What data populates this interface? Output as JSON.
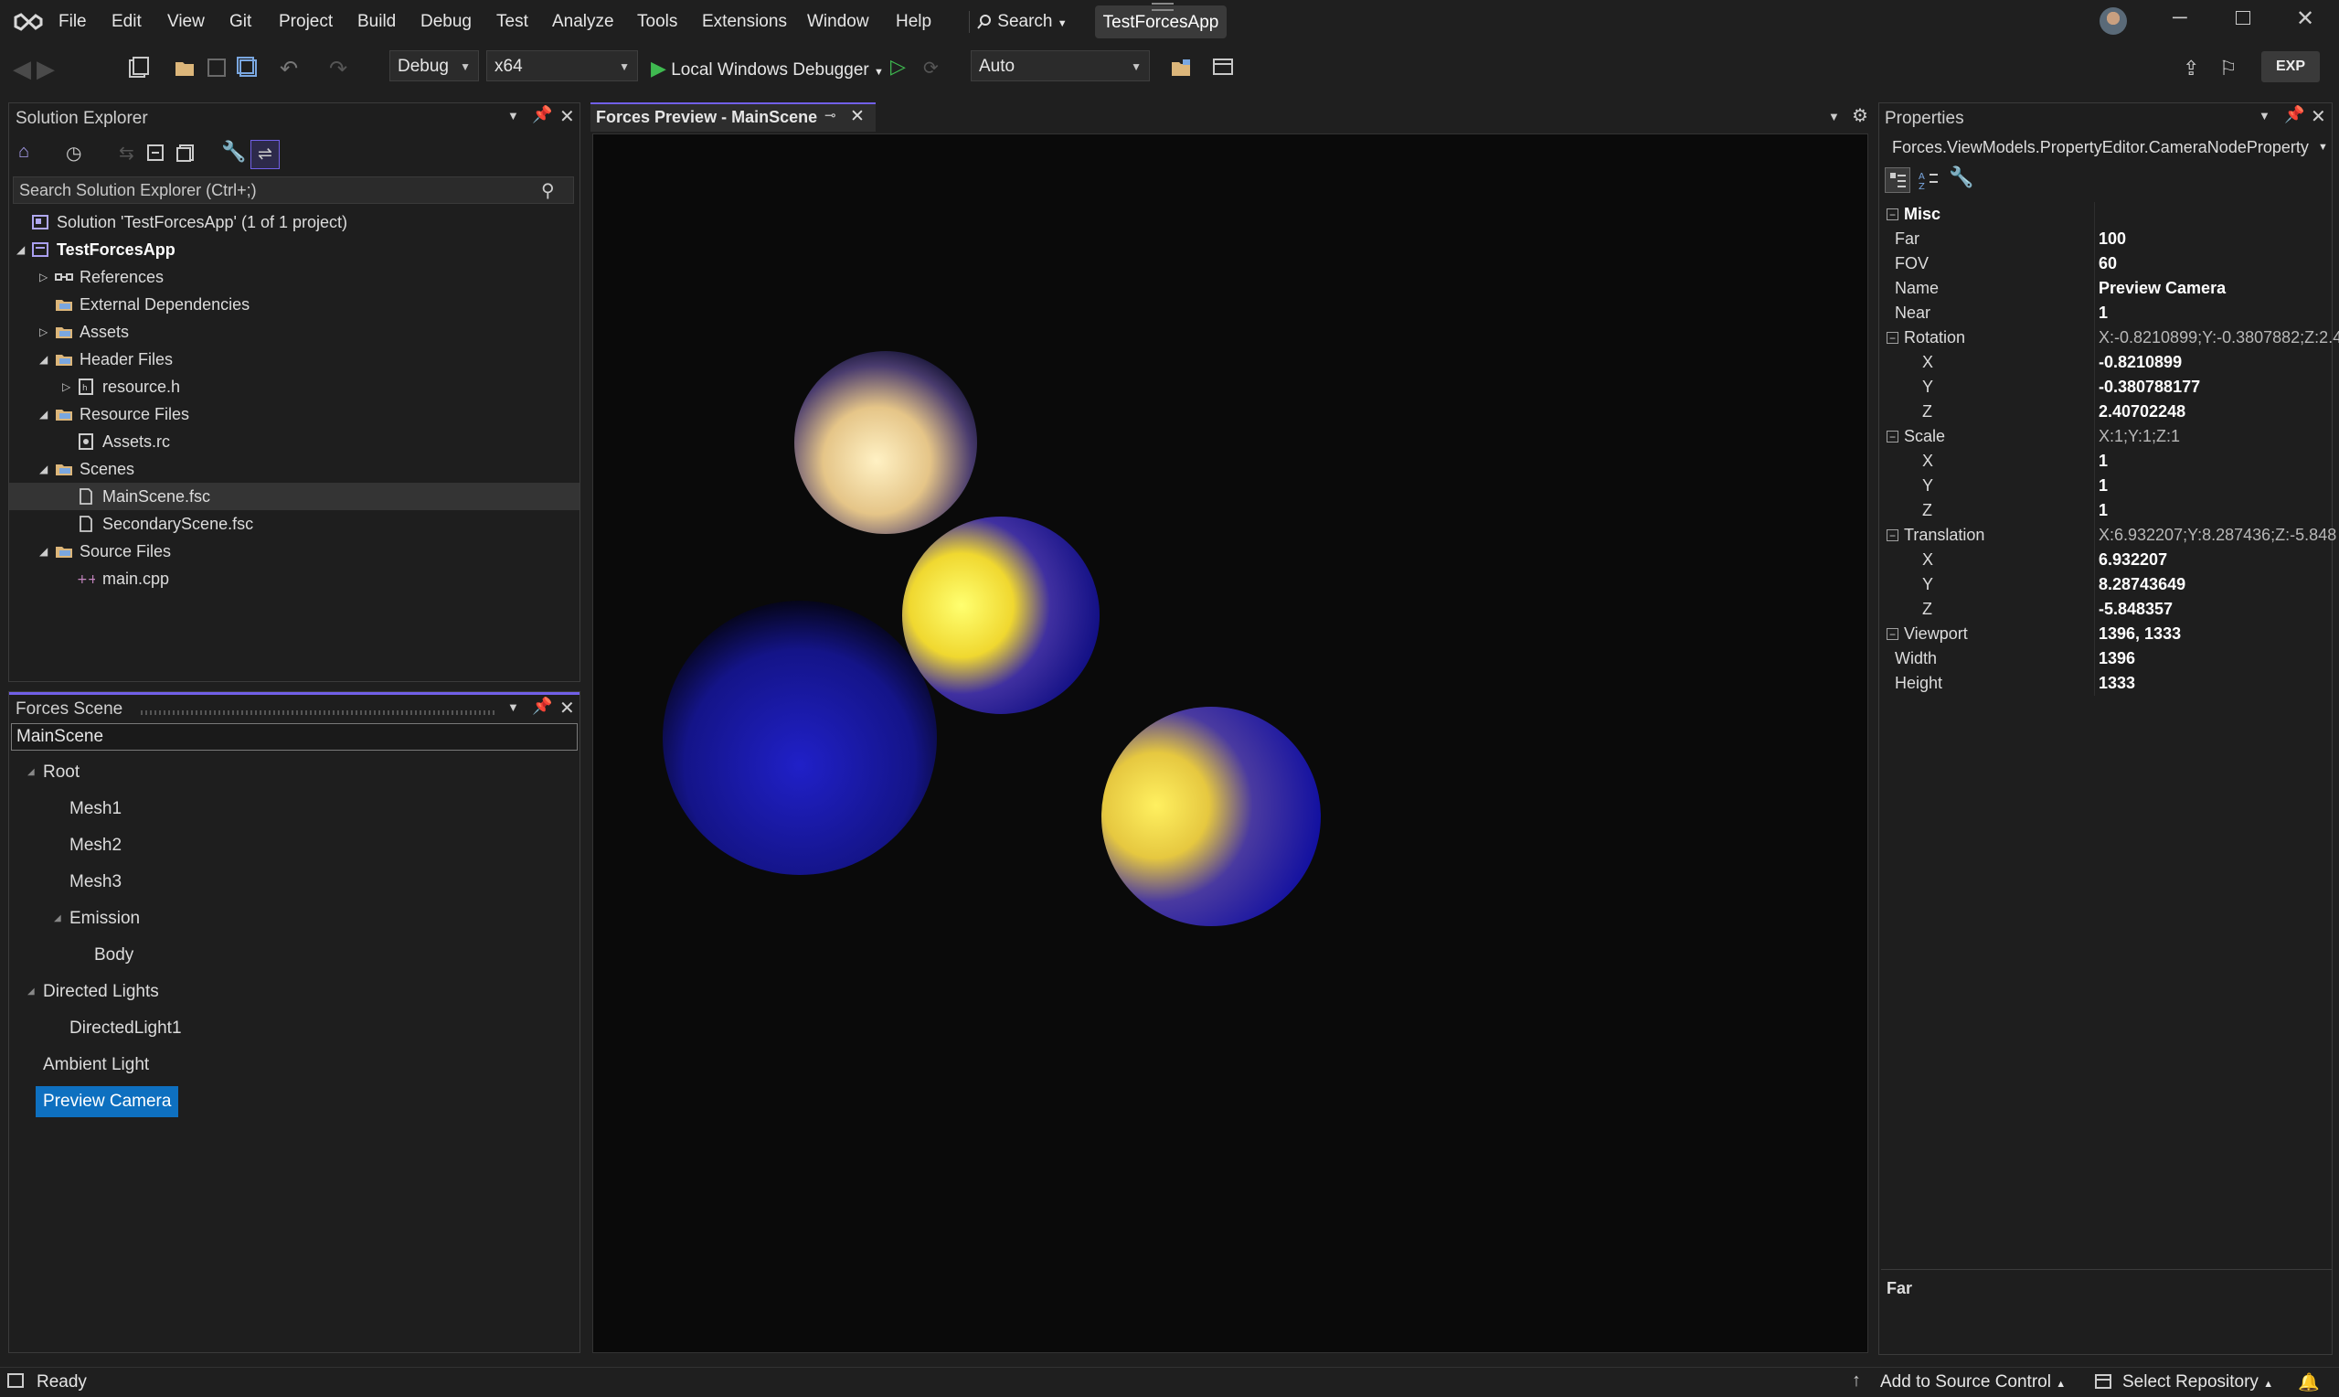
{
  "menubar": {
    "items": [
      "File",
      "Edit",
      "View",
      "Git",
      "Project",
      "Build",
      "Debug",
      "Test",
      "Analyze",
      "Tools",
      "Extensions",
      "Window",
      "Help"
    ],
    "search_label": "Search",
    "solution_name": "TestForcesApp"
  },
  "toolbar": {
    "config": "Debug",
    "platform": "x64",
    "debugger": "Local Windows Debugger",
    "scale": "Auto",
    "exp_badge": "EXP"
  },
  "solution_explorer": {
    "title": "Solution Explorer",
    "search_placeholder": "Search Solution Explorer (Ctrl+;)",
    "items": [
      {
        "label": "Solution 'TestForcesApp' (1 of 1 project)",
        "level": 0,
        "expander": "",
        "icon": "solution-icon",
        "bold": false
      },
      {
        "label": "TestForcesApp",
        "level": 0,
        "expander": "open",
        "icon": "project-icon",
        "bold": true
      },
      {
        "label": "References",
        "level": 1,
        "expander": "closed",
        "icon": "references-icon",
        "bold": false
      },
      {
        "label": "External Dependencies",
        "level": 1,
        "expander": "",
        "icon": "folder-icon",
        "bold": false
      },
      {
        "label": "Assets",
        "level": 1,
        "expander": "closed",
        "icon": "folder-icon",
        "bold": false
      },
      {
        "label": "Header Files",
        "level": 1,
        "expander": "open",
        "icon": "folder-icon",
        "bold": false
      },
      {
        "label": "resource.h",
        "level": 2,
        "expander": "closed",
        "icon": "header-file-icon",
        "bold": false
      },
      {
        "label": "Resource Files",
        "level": 1,
        "expander": "open",
        "icon": "folder-icon",
        "bold": false
      },
      {
        "label": "Assets.rc",
        "level": 2,
        "expander": "",
        "icon": "resource-file-icon",
        "bold": false
      },
      {
        "label": "Scenes",
        "level": 1,
        "expander": "open",
        "icon": "folder-icon",
        "bold": false
      },
      {
        "label": "MainScene.fsc",
        "level": 2,
        "expander": "",
        "icon": "file-icon",
        "bold": false
      },
      {
        "label": "SecondaryScene.fsc",
        "level": 2,
        "expander": "",
        "icon": "file-icon",
        "bold": false
      },
      {
        "label": "Source Files",
        "level": 1,
        "expander": "open",
        "icon": "folder-icon",
        "bold": false
      },
      {
        "label": "main.cpp",
        "level": 2,
        "expander": "",
        "icon": "cpp-file-icon",
        "bold": false
      }
    ],
    "selected_index": 10
  },
  "forces_scene": {
    "title": "Forces Scene",
    "scene_name": "MainScene",
    "nodes": [
      {
        "label": "Root",
        "level": 0,
        "expander": true
      },
      {
        "label": "Mesh1",
        "level": 1,
        "expander": false
      },
      {
        "label": "Mesh2",
        "level": 1,
        "expander": false
      },
      {
        "label": "Mesh3",
        "level": 1,
        "expander": false
      },
      {
        "label": "Emission",
        "level": 1,
        "expander": true
      },
      {
        "label": "Body",
        "level": 2,
        "expander": false
      },
      {
        "label": "Directed Lights",
        "level": 0,
        "expander": true
      },
      {
        "label": "DirectedLight1",
        "level": 1,
        "expander": false
      },
      {
        "label": "Ambient Light",
        "level": 0,
        "expander": false
      },
      {
        "label": "Preview Camera",
        "level": 0,
        "expander": false
      }
    ],
    "selected_index": 9
  },
  "preview": {
    "tab_title": "Forces Preview - MainScene"
  },
  "properties": {
    "title": "Properties",
    "object": "Forces.ViewModels.PropertyEditor.CameraNodeProperty",
    "rows": [
      {
        "kind": "category",
        "name": "Misc",
        "value": "",
        "expander": "-"
      },
      {
        "kind": "prop",
        "name": "Far",
        "value": "100",
        "indent": 1,
        "bold": true
      },
      {
        "kind": "prop",
        "name": "FOV",
        "value": "60",
        "indent": 1,
        "bold": true
      },
      {
        "kind": "prop",
        "name": "Name",
        "value": "Preview Camera",
        "indent": 1,
        "bold": true
      },
      {
        "kind": "prop",
        "name": "Near",
        "value": "1",
        "indent": 1,
        "bold": true
      },
      {
        "kind": "group",
        "name": "Rotation",
        "value": "X:-0.8210899;Y:-0.3807882;Z:2.4",
        "expander": "-"
      },
      {
        "kind": "prop",
        "name": "X",
        "value": "-0.8210899",
        "indent": 2,
        "bold": true
      },
      {
        "kind": "prop",
        "name": "Y",
        "value": "-0.380788177",
        "indent": 2,
        "bold": true
      },
      {
        "kind": "prop",
        "name": "Z",
        "value": "2.40702248",
        "indent": 2,
        "bold": true
      },
      {
        "kind": "group",
        "name": "Scale",
        "value": "X:1;Y:1;Z:1",
        "expander": "-"
      },
      {
        "kind": "prop",
        "name": "X",
        "value": "1",
        "indent": 2,
        "bold": true
      },
      {
        "kind": "prop",
        "name": "Y",
        "value": "1",
        "indent": 2,
        "bold": true
      },
      {
        "kind": "prop",
        "name": "Z",
        "value": "1",
        "indent": 2,
        "bold": true
      },
      {
        "kind": "group",
        "name": "Translation",
        "value": "X:6.932207;Y:8.287436;Z:-5.848",
        "expander": "-"
      },
      {
        "kind": "prop",
        "name": "X",
        "value": "6.932207",
        "indent": 2,
        "bold": true
      },
      {
        "kind": "prop",
        "name": "Y",
        "value": "8.28743649",
        "indent": 2,
        "bold": true
      },
      {
        "kind": "prop",
        "name": "Z",
        "value": "-5.848357",
        "indent": 2,
        "bold": true
      },
      {
        "kind": "group",
        "name": "Viewport",
        "value": "1396, 1333",
        "expander": "-",
        "bold": true
      },
      {
        "kind": "prop",
        "name": "Width",
        "value": "1396",
        "indent": 1,
        "bold": true
      },
      {
        "kind": "prop",
        "name": "Height",
        "value": "1333",
        "indent": 1,
        "bold": true
      }
    ],
    "description_title": "Far"
  },
  "statusbar": {
    "status": "Ready",
    "source_control": "Add to Source Control",
    "repository": "Select Repository"
  },
  "colors": {
    "accent": "#0e70c0",
    "selection_purple": "#7160e8",
    "background": "#1f1f1f",
    "viewport_bg": "#0a0a0a"
  }
}
